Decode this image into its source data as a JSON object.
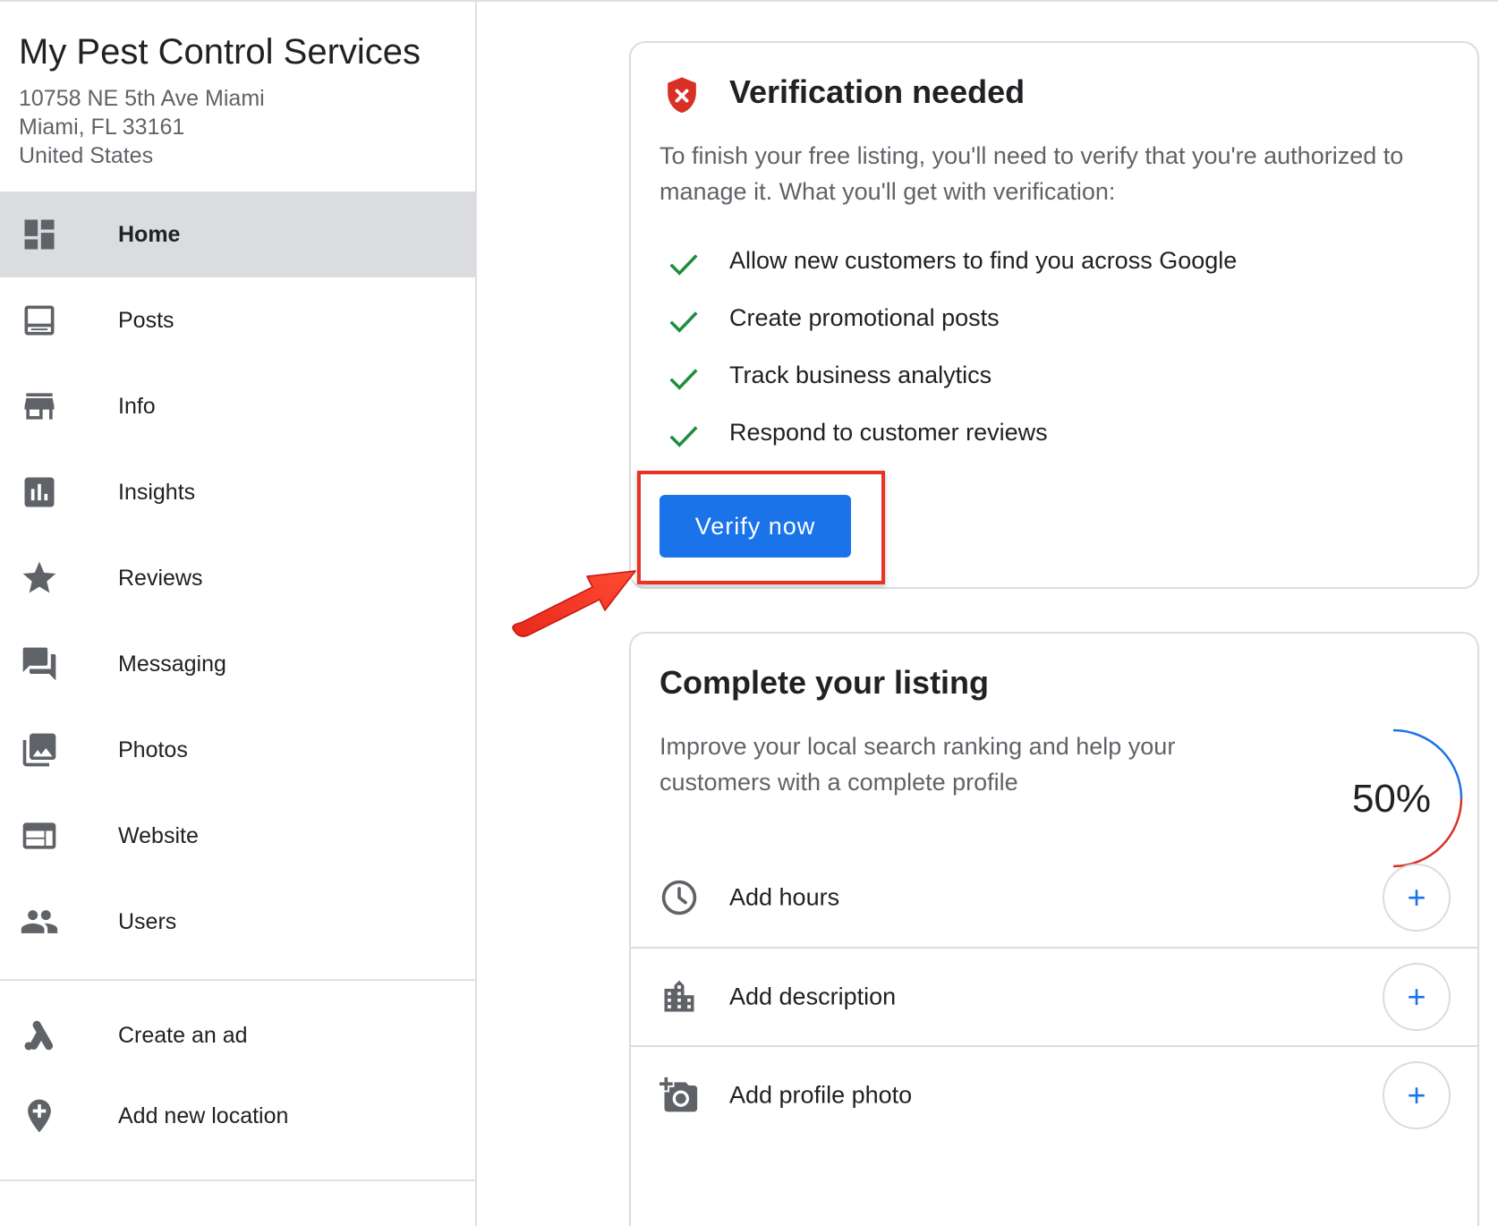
{
  "business": {
    "name": "My Pest Control Services",
    "address_line1": "10758 NE 5th Ave Miami",
    "address_line2": "Miami, FL 33161",
    "address_line3": "United States"
  },
  "sidebar": {
    "items": [
      {
        "label": "Home",
        "icon": "dashboard-icon",
        "active": true
      },
      {
        "label": "Posts",
        "icon": "posts-icon"
      },
      {
        "label": "Info",
        "icon": "storefront-icon"
      },
      {
        "label": "Insights",
        "icon": "bar-chart-icon"
      },
      {
        "label": "Reviews",
        "icon": "star-icon"
      },
      {
        "label": "Messaging",
        "icon": "chat-icon"
      },
      {
        "label": "Photos",
        "icon": "photo-library-icon"
      },
      {
        "label": "Website",
        "icon": "web-icon"
      },
      {
        "label": "Users",
        "icon": "people-icon"
      }
    ],
    "secondary": [
      {
        "label": "Create an ad",
        "icon": "google-ads-icon"
      },
      {
        "label": "Add new location",
        "icon": "add-location-icon"
      }
    ]
  },
  "verification": {
    "title": "Verification needed",
    "description": "To finish your free listing, you'll need to verify that you're authorized to manage it. What you'll get with verification:",
    "benefits": [
      "Allow new customers to find you across Google",
      "Create promotional posts",
      "Track business analytics",
      "Respond to customer reviews"
    ],
    "button_label": "Verify now"
  },
  "listing": {
    "title": "Complete your listing",
    "description": "Improve your local search ranking and help your customers with a complete profile",
    "progress_value": 0.5,
    "progress_label": "50%",
    "tasks": [
      {
        "label": "Add hours",
        "icon": "clock-icon",
        "action": "+"
      },
      {
        "label": "Add description",
        "icon": "building-icon",
        "action": "+"
      },
      {
        "label": "Add profile photo",
        "icon": "add-photo-icon",
        "action": "+"
      }
    ]
  },
  "colors": {
    "accent": "#1a73e8",
    "check": "#1e8e3e",
    "alert": "#d93025",
    "highlight": "#ea3323",
    "active_nav": "#dadce0"
  }
}
